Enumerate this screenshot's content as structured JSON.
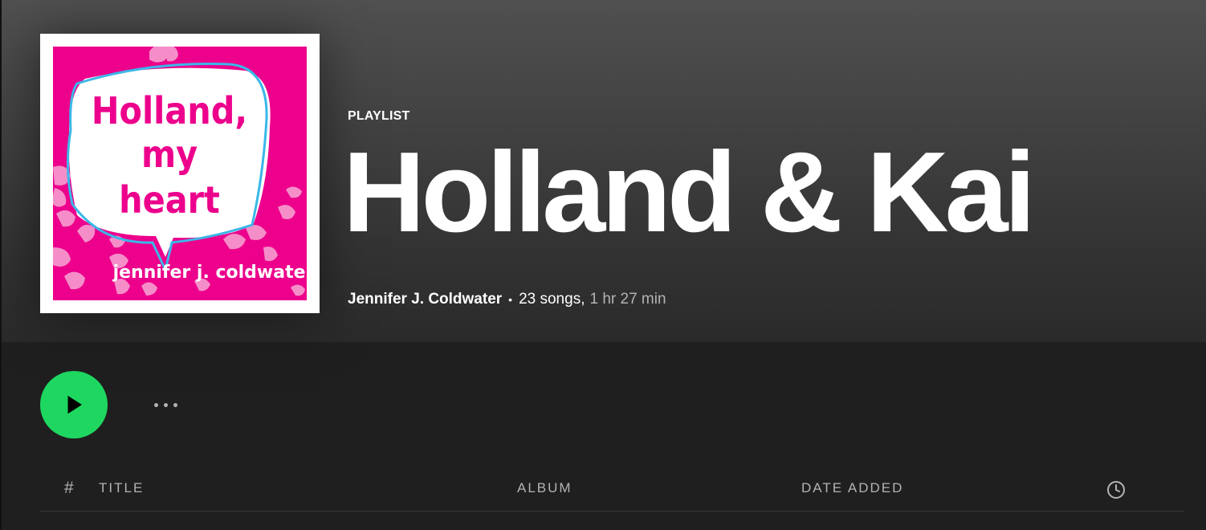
{
  "playlist": {
    "type_label": "PLAYLIST",
    "title": "Holland & Kai",
    "owner": "Jennifer J. Coldwater",
    "separator": "•",
    "song_count": "23 songs,",
    "duration": "1 hr 27 min",
    "cover": {
      "title_lines": [
        "Holland,",
        "my",
        "heart"
      ],
      "author": "jennifer j. coldwater",
      "background_color": "#ec008c",
      "text_color": "#ec008c",
      "accent_color": "#3bb7e8"
    }
  },
  "controls": {
    "play_icon": "play-icon",
    "more_icon": "more-options-icon",
    "accent_color": "#1ed760"
  },
  "table_header": {
    "number": "#",
    "title": "TITLE",
    "album": "ALBUM",
    "date_added": "DATE ADDED",
    "duration_icon": "clock-icon"
  }
}
